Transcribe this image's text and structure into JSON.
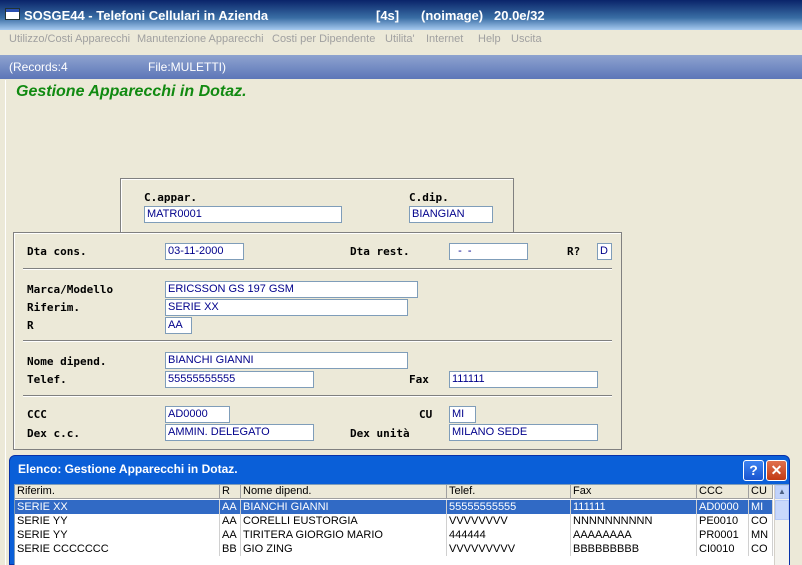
{
  "window": {
    "title": "SOSGE44 - Telefoni Cellulari in Azienda",
    "time": "[4s]",
    "image": "(noimage)",
    "version": "20.0e/32"
  },
  "menu": [
    "Utilizzo/Costi Apparecchi",
    "Manutenzione Apparecchi",
    "Costi per Dipendente",
    "Utilita'",
    "Internet",
    "Help",
    "Uscita"
  ],
  "status": {
    "records": "(Records:4",
    "file": "File:MULETTI)"
  },
  "page_title": "Gestione Apparecchi in Dotaz.",
  "key": {
    "c_appar_label": "C.appar.",
    "c_appar_value": "MATR0001",
    "c_dip_label": "C.dip.",
    "c_dip_value": "BIANGIAN"
  },
  "detail": {
    "dta_cons_label": "Dta cons.",
    "dta_cons_value": "03-11-2000",
    "dta_rest_label": "Dta rest.",
    "dta_rest_value": "  -  -",
    "r_q_label": "R?",
    "r_q_value": "D",
    "marca_label": "Marca/Modello",
    "marca_value": "ERICSSON GS 197 GSM",
    "riferim_label": "Riferim.",
    "riferim_value": "SERIE XX",
    "r_label": "R",
    "r_value": "AA",
    "nome_label": "Nome dipend.",
    "nome_value": "BIANCHI GIANNI",
    "telef_label": "Telef.",
    "telef_value": "55555555555",
    "fax_label": "Fax",
    "fax_value": "111111",
    "ccc_label": "CCC",
    "ccc_value": "AD0000",
    "cu_label": "CU",
    "cu_value": "MI",
    "dexcc_label": "Dex c.c.",
    "dexcc_value": "AMMIN. DELEGATO",
    "dexunita_label": "Dex unità",
    "dexunita_value": "MILANO SEDE"
  },
  "popup": {
    "title": "Elenco: Gestione Apparecchi in Dotaz.",
    "help": "?",
    "close": "✕",
    "columns": [
      "Riferim.",
      "R",
      "Nome dipend.",
      "Telef.",
      "Fax",
      "CCC",
      "CU"
    ],
    "rows": [
      [
        "SERIE XX",
        "AA",
        "BIANCHI GIANNI",
        "55555555555",
        "111111",
        "AD0000",
        "MI"
      ],
      [
        "SERIE YY",
        "AA",
        "CORELLI EUSTORGIA",
        "VVVVVVVV",
        "NNNNNNNNNN",
        "PE0010",
        "CO"
      ],
      [
        "SERIE YY",
        "AA",
        "TIRITERA GIORGIO MARIO",
        "444444",
        "AAAAAAAA",
        "PR0001",
        "MN"
      ],
      [
        "SERIE CCCCCCC",
        "BB",
        "GIO ZING",
        "VVVVVVVVV",
        "BBBBBBBBB",
        "CI0010",
        "CO"
      ]
    ],
    "selected_row": 0
  }
}
